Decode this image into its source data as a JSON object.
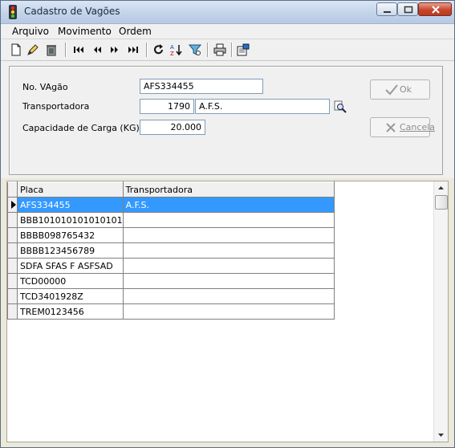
{
  "window": {
    "title": "Cadastro de Vagões"
  },
  "menu": [
    "Arquivo",
    "Movimento",
    "Ordem"
  ],
  "toolbar": {
    "icons": [
      "new-document-icon",
      "edit-pencil-icon",
      "delete-trash-icon",
      "first-record-icon",
      "previous-record-icon",
      "next-record-icon",
      "last-record-icon",
      "refresh-icon",
      "sort-az-icon",
      "filter-icon",
      "print-icon",
      "export-icon"
    ]
  },
  "form": {
    "wagon_no_label": "No. VAgão",
    "wagon_no_value": "AFS334455",
    "carrier_label": "Transportadora",
    "carrier_code": "1790",
    "carrier_name": "A.F.S.",
    "capacity_label": "Capacidade de Carga (KG)",
    "capacity_value": "20.000",
    "ok_label": "Ok",
    "cancel_label": "Cancela"
  },
  "grid": {
    "columns": [
      "Placa",
      "Transportadora"
    ],
    "rows": [
      {
        "placa": "AFS334455",
        "transportadora": "A.F.S."
      },
      {
        "placa": "BBB101010101010101",
        "transportadora": ""
      },
      {
        "placa": "BBBB098765432",
        "transportadora": ""
      },
      {
        "placa": "BBBB123456789",
        "transportadora": ""
      },
      {
        "placa": "SDFA SFAS F ASFSAD",
        "transportadora": ""
      },
      {
        "placa": "TCD00000",
        "transportadora": ""
      },
      {
        "placa": "TCD3401928Z",
        "transportadora": ""
      },
      {
        "placa": "TREM0123456",
        "transportadora": ""
      }
    ],
    "selected_row": 0
  },
  "colors": {
    "selection": "#3399ff",
    "window_bg": "#f0f0f0"
  }
}
